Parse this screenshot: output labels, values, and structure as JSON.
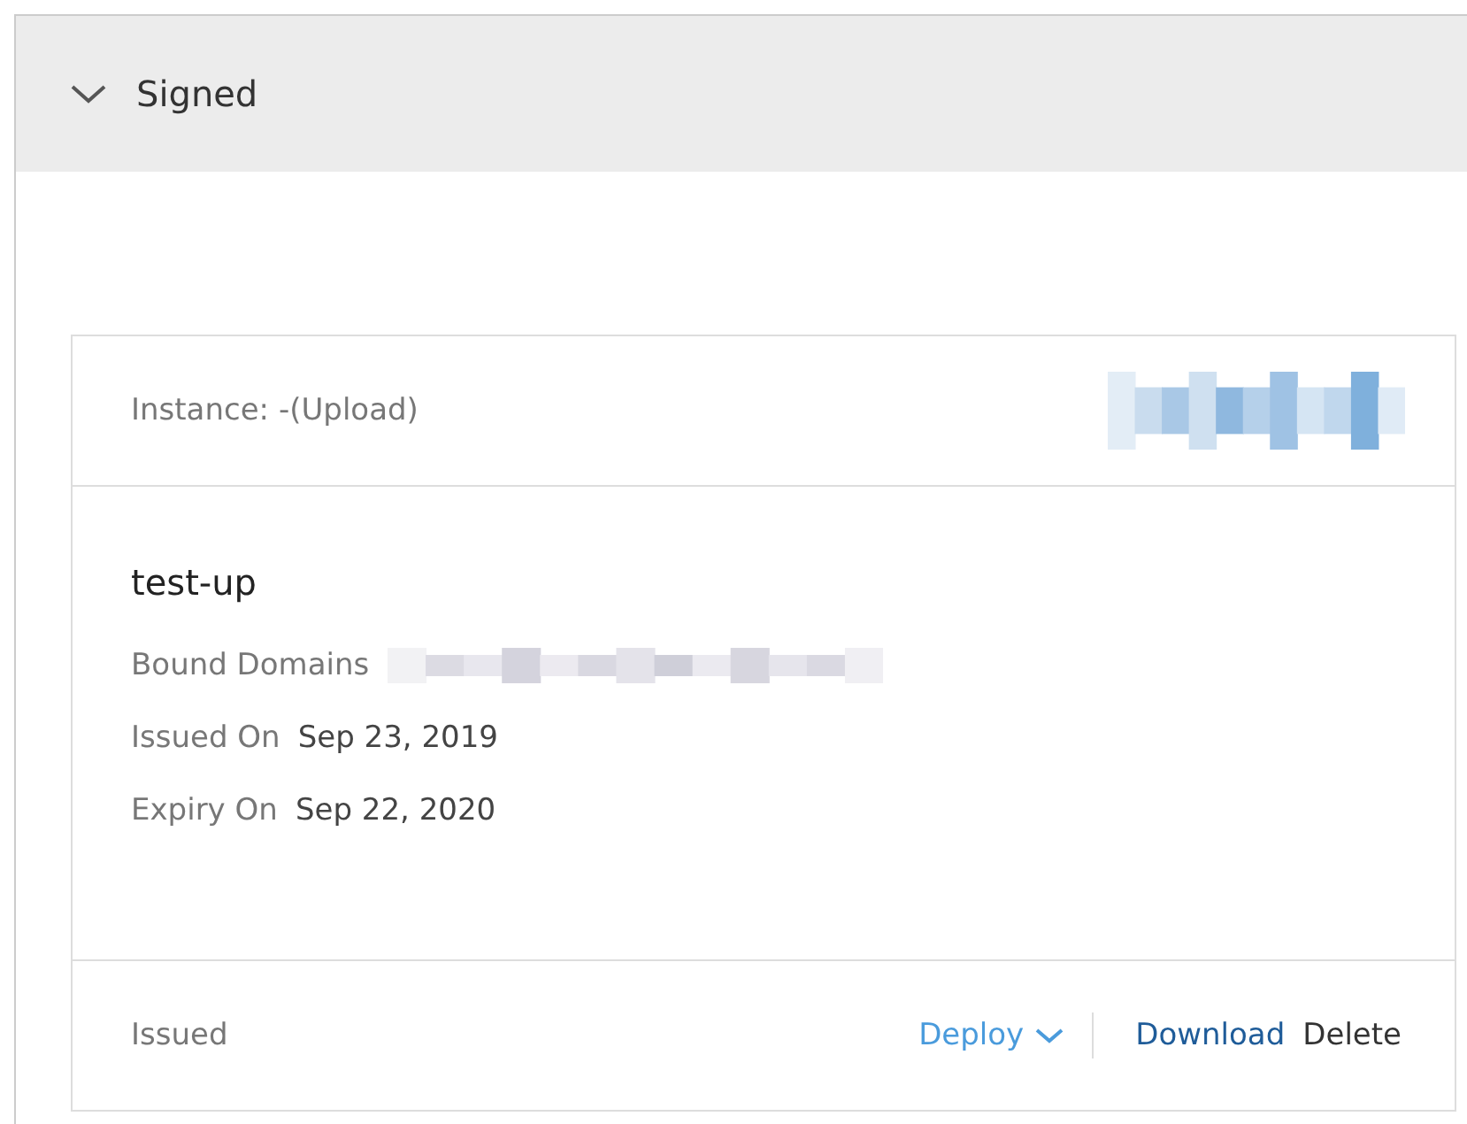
{
  "section": {
    "title": "Signed",
    "expanded": true
  },
  "card": {
    "instance": "Instance: -(Upload)",
    "name": "test-up",
    "fields": [
      {
        "label": "Bound Domains",
        "kind": "redacted"
      },
      {
        "label": "Issued On",
        "value": "Sep 23, 2019",
        "kind": "text"
      },
      {
        "label": "Expiry On",
        "value": "Sep 22, 2020",
        "kind": "text"
      }
    ],
    "status": "Issued",
    "actions": [
      {
        "label": "Deploy",
        "kind": "dropdown"
      },
      {
        "label": "Download",
        "kind": "link"
      },
      {
        "label": "Delete",
        "kind": "plain"
      }
    ]
  }
}
